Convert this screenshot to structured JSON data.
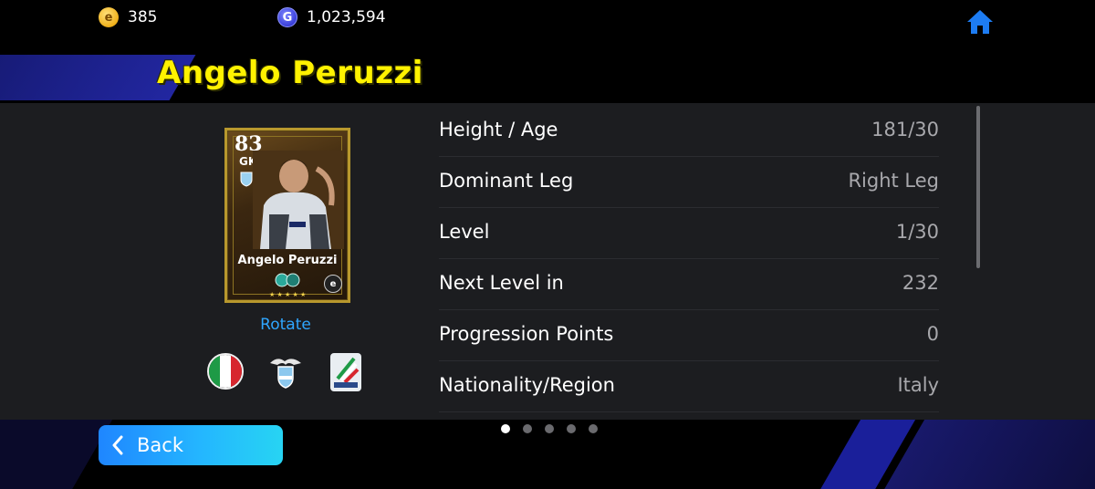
{
  "currencies": {
    "ecoin": {
      "icon": "ecoin-icon",
      "value": "385"
    },
    "gp": {
      "icon": "gp-coin-icon",
      "value": "1,023,594"
    }
  },
  "player": {
    "name": "Angelo Peruzzi",
    "card": {
      "rating": "83",
      "position": "GK",
      "name": "Angelo Peruzzi"
    }
  },
  "rotate_label": "Rotate",
  "details": [
    {
      "label": "Height / Age",
      "value": "181/30"
    },
    {
      "label": "Dominant Leg",
      "value": "Right Leg"
    },
    {
      "label": "Level",
      "value": "1/30"
    },
    {
      "label": "Next Level in",
      "value": "232"
    },
    {
      "label": "Progression Points",
      "value": "0"
    },
    {
      "label": "Nationality/Region",
      "value": "Italy"
    }
  ],
  "pagination": {
    "pages": 5,
    "current": 1
  },
  "back_label": "Back",
  "colors": {
    "title": "#fff200",
    "accent_blue": "#2fa6ff",
    "panel": "#1c1d20",
    "value_text": "#a8a8ac"
  }
}
